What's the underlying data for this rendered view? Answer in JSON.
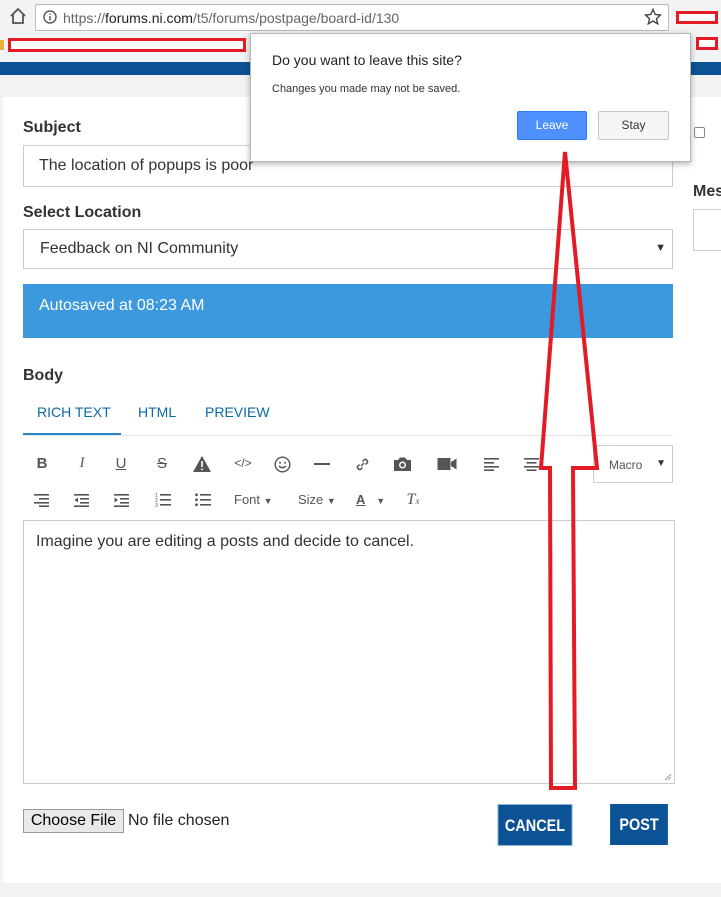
{
  "browser": {
    "url_prefix": "https://",
    "url_host": "forums.ni.com",
    "url_path": "/t5/forums/postpage/board-id/130"
  },
  "form": {
    "subject_label": "Subject",
    "subject_value": "The location of popups is poor",
    "location_label": "Select Location",
    "location_value": "Feedback on NI Community",
    "autosave_text": "Autosaved at 08:23 AM",
    "body_label": "Body",
    "tabs": [
      "RICH TEXT",
      "HTML",
      "PREVIEW"
    ],
    "toolbar": {
      "macro_label": "Macro",
      "font_label": "Font",
      "size_label": "Size",
      "color_letter": "A"
    },
    "editor_text": "Imagine you are editing a posts and decide to cancel.",
    "choose_file_label": "Choose File",
    "no_file_text": "No file chosen",
    "cancel_label": "CANCEL",
    "post_label": "POST",
    "side_label": "Mes"
  },
  "dialog": {
    "title": "Do you want to leave this site?",
    "message": "Changes you made may not be saved.",
    "leave_label": "Leave",
    "stay_label": "Stay"
  },
  "colors": {
    "brand_blue": "#0b5394",
    "autosave_blue": "#3d99de",
    "annotation_red": "#e21b25",
    "leave_blue": "#4d90fe"
  }
}
